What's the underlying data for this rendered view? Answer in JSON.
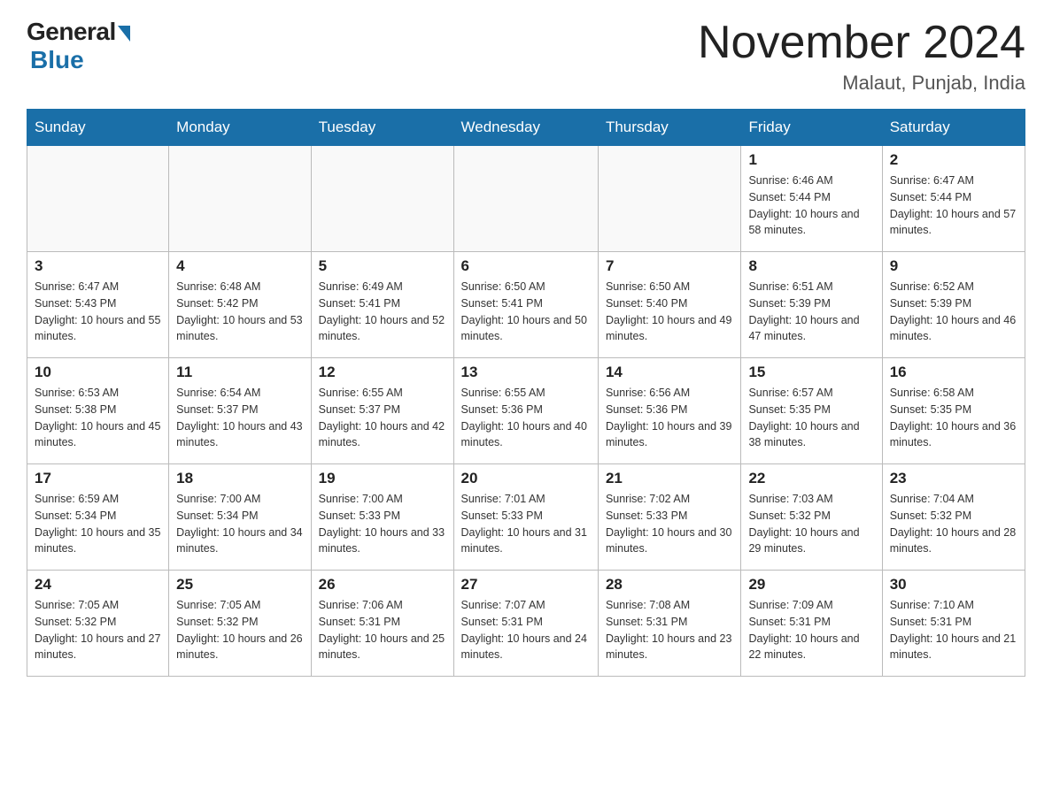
{
  "header": {
    "logo_general": "General",
    "logo_blue": "Blue",
    "month_title": "November 2024",
    "location": "Malaut, Punjab, India"
  },
  "days_of_week": [
    "Sunday",
    "Monday",
    "Tuesday",
    "Wednesday",
    "Thursday",
    "Friday",
    "Saturday"
  ],
  "weeks": [
    [
      {
        "day": "",
        "info": ""
      },
      {
        "day": "",
        "info": ""
      },
      {
        "day": "",
        "info": ""
      },
      {
        "day": "",
        "info": ""
      },
      {
        "day": "",
        "info": ""
      },
      {
        "day": "1",
        "info": "Sunrise: 6:46 AM\nSunset: 5:44 PM\nDaylight: 10 hours and 58 minutes."
      },
      {
        "day": "2",
        "info": "Sunrise: 6:47 AM\nSunset: 5:44 PM\nDaylight: 10 hours and 57 minutes."
      }
    ],
    [
      {
        "day": "3",
        "info": "Sunrise: 6:47 AM\nSunset: 5:43 PM\nDaylight: 10 hours and 55 minutes."
      },
      {
        "day": "4",
        "info": "Sunrise: 6:48 AM\nSunset: 5:42 PM\nDaylight: 10 hours and 53 minutes."
      },
      {
        "day": "5",
        "info": "Sunrise: 6:49 AM\nSunset: 5:41 PM\nDaylight: 10 hours and 52 minutes."
      },
      {
        "day": "6",
        "info": "Sunrise: 6:50 AM\nSunset: 5:41 PM\nDaylight: 10 hours and 50 minutes."
      },
      {
        "day": "7",
        "info": "Sunrise: 6:50 AM\nSunset: 5:40 PM\nDaylight: 10 hours and 49 minutes."
      },
      {
        "day": "8",
        "info": "Sunrise: 6:51 AM\nSunset: 5:39 PM\nDaylight: 10 hours and 47 minutes."
      },
      {
        "day": "9",
        "info": "Sunrise: 6:52 AM\nSunset: 5:39 PM\nDaylight: 10 hours and 46 minutes."
      }
    ],
    [
      {
        "day": "10",
        "info": "Sunrise: 6:53 AM\nSunset: 5:38 PM\nDaylight: 10 hours and 45 minutes."
      },
      {
        "day": "11",
        "info": "Sunrise: 6:54 AM\nSunset: 5:37 PM\nDaylight: 10 hours and 43 minutes."
      },
      {
        "day": "12",
        "info": "Sunrise: 6:55 AM\nSunset: 5:37 PM\nDaylight: 10 hours and 42 minutes."
      },
      {
        "day": "13",
        "info": "Sunrise: 6:55 AM\nSunset: 5:36 PM\nDaylight: 10 hours and 40 minutes."
      },
      {
        "day": "14",
        "info": "Sunrise: 6:56 AM\nSunset: 5:36 PM\nDaylight: 10 hours and 39 minutes."
      },
      {
        "day": "15",
        "info": "Sunrise: 6:57 AM\nSunset: 5:35 PM\nDaylight: 10 hours and 38 minutes."
      },
      {
        "day": "16",
        "info": "Sunrise: 6:58 AM\nSunset: 5:35 PM\nDaylight: 10 hours and 36 minutes."
      }
    ],
    [
      {
        "day": "17",
        "info": "Sunrise: 6:59 AM\nSunset: 5:34 PM\nDaylight: 10 hours and 35 minutes."
      },
      {
        "day": "18",
        "info": "Sunrise: 7:00 AM\nSunset: 5:34 PM\nDaylight: 10 hours and 34 minutes."
      },
      {
        "day": "19",
        "info": "Sunrise: 7:00 AM\nSunset: 5:33 PM\nDaylight: 10 hours and 33 minutes."
      },
      {
        "day": "20",
        "info": "Sunrise: 7:01 AM\nSunset: 5:33 PM\nDaylight: 10 hours and 31 minutes."
      },
      {
        "day": "21",
        "info": "Sunrise: 7:02 AM\nSunset: 5:33 PM\nDaylight: 10 hours and 30 minutes."
      },
      {
        "day": "22",
        "info": "Sunrise: 7:03 AM\nSunset: 5:32 PM\nDaylight: 10 hours and 29 minutes."
      },
      {
        "day": "23",
        "info": "Sunrise: 7:04 AM\nSunset: 5:32 PM\nDaylight: 10 hours and 28 minutes."
      }
    ],
    [
      {
        "day": "24",
        "info": "Sunrise: 7:05 AM\nSunset: 5:32 PM\nDaylight: 10 hours and 27 minutes."
      },
      {
        "day": "25",
        "info": "Sunrise: 7:05 AM\nSunset: 5:32 PM\nDaylight: 10 hours and 26 minutes."
      },
      {
        "day": "26",
        "info": "Sunrise: 7:06 AM\nSunset: 5:31 PM\nDaylight: 10 hours and 25 minutes."
      },
      {
        "day": "27",
        "info": "Sunrise: 7:07 AM\nSunset: 5:31 PM\nDaylight: 10 hours and 24 minutes."
      },
      {
        "day": "28",
        "info": "Sunrise: 7:08 AM\nSunset: 5:31 PM\nDaylight: 10 hours and 23 minutes."
      },
      {
        "day": "29",
        "info": "Sunrise: 7:09 AM\nSunset: 5:31 PM\nDaylight: 10 hours and 22 minutes."
      },
      {
        "day": "30",
        "info": "Sunrise: 7:10 AM\nSunset: 5:31 PM\nDaylight: 10 hours and 21 minutes."
      }
    ]
  ]
}
